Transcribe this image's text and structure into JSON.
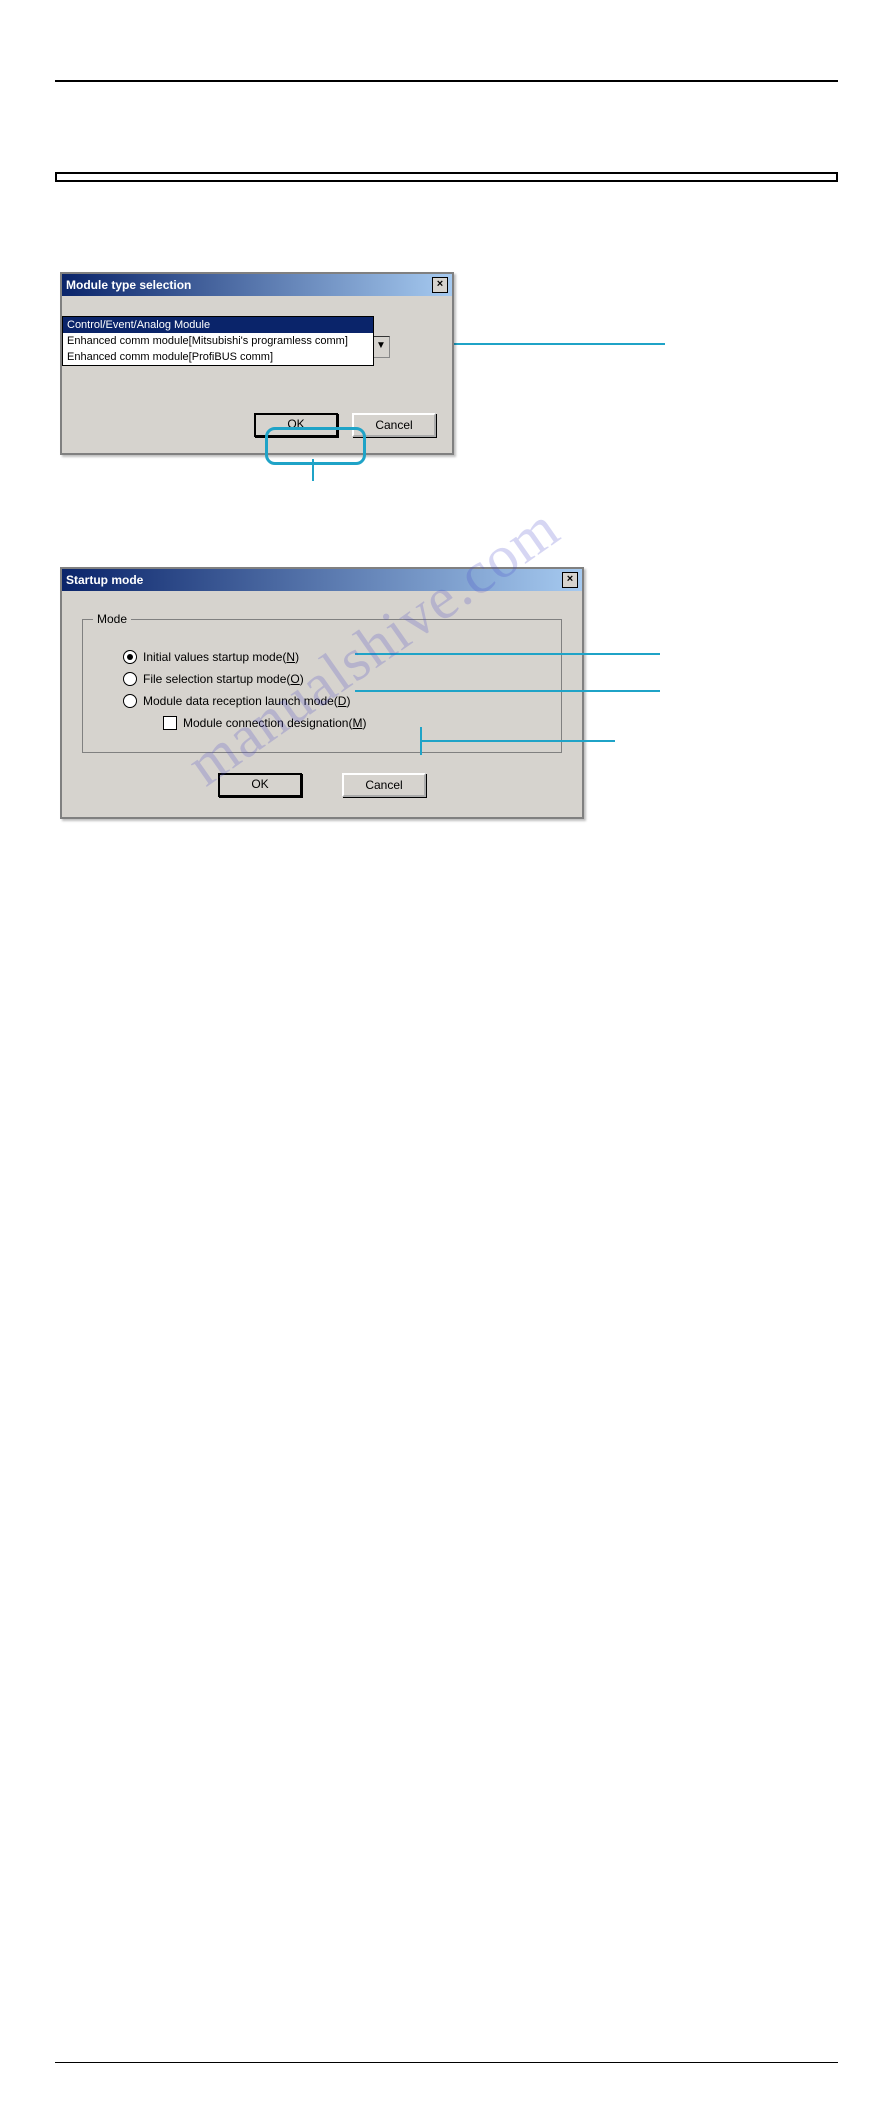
{
  "watermark": "manualshive.com",
  "dialog1": {
    "title": "Module type selection",
    "close_glyph": "×",
    "combo_selected": "Control/Event/Analog Module",
    "combo_options": [
      "Control/Event/Analog Module",
      "Enhanced comm module[Mitsubishi's programless comm]",
      "Enhanced comm module[ProfiBUS comm]"
    ],
    "ok_label": "OK",
    "cancel_label": "Cancel"
  },
  "dialog2": {
    "title": "Startup mode",
    "close_glyph": "×",
    "group_legend": "Mode",
    "radio1_pre": "Initial values startup mode(",
    "radio1_key": "N",
    "radio2_pre": "File selection startup mode(",
    "radio2_key": "O",
    "radio3_pre": "Module data reception launch mode(",
    "radio3_key": "D",
    "check_pre": "Module connection designation(",
    "check_key": "M",
    "close_paren": ")",
    "ok_label": "OK",
    "cancel_label": "Cancel"
  }
}
